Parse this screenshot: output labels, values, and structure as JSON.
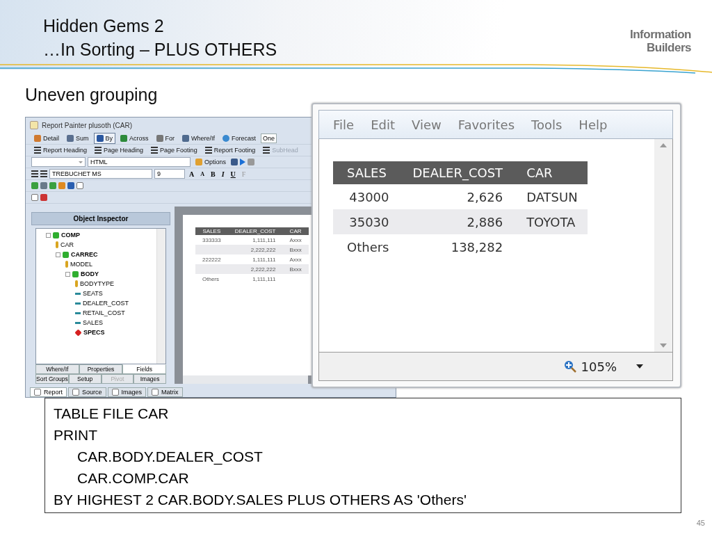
{
  "slide": {
    "title": "Hidden Gems 2",
    "subtitle": "…In Sorting – PLUS OTHERS",
    "logo_lines": [
      "Information",
      "Builders"
    ],
    "heading": "Uneven grouping",
    "page_number": "45"
  },
  "painter": {
    "title": "Report Painter plusoth (CAR)",
    "toolbar_1": [
      {
        "label": "Detail",
        "kind": "person",
        "selected": false
      },
      {
        "label": "Sum",
        "kind": "sigma",
        "selected": false
      },
      {
        "label": "By",
        "kind": "down",
        "selected": true
      },
      {
        "label": "Across",
        "kind": "right",
        "selected": false
      },
      {
        "label": "For",
        "kind": "list",
        "selected": false
      },
      {
        "label": "Where/If",
        "kind": "funnel",
        "selected": false
      },
      {
        "label": "Forecast",
        "kind": "globe",
        "selected": false
      }
    ],
    "toolbar_1_field": "One",
    "toolbar_2": [
      {
        "label": "Report Heading",
        "disabled": false
      },
      {
        "label": "Page Heading",
        "disabled": false
      },
      {
        "label": "Page Footing",
        "disabled": false
      },
      {
        "label": "Report Footing",
        "disabled": false
      },
      {
        "label": "SubHead",
        "disabled": true
      }
    ],
    "format_combo": "HTML",
    "options_button": "Options",
    "font_combo": "TREBUCHET MS",
    "size_combo": "9",
    "style_buttons": [
      "A",
      "A",
      "B",
      "I",
      "U",
      "F"
    ],
    "inspector_title": "Object Inspector",
    "tree": [
      {
        "label": "COMP",
        "kind": "segment",
        "children": [
          {
            "label": "CAR",
            "kind": "key"
          },
          {
            "label": "CARREC",
            "kind": "segment",
            "children": [
              {
                "label": "MODEL",
                "kind": "key"
              },
              {
                "label": "BODY",
                "kind": "segment",
                "children": [
                  {
                    "label": "BODYTYPE",
                    "kind": "key"
                  },
                  {
                    "label": "SEATS",
                    "kind": "field"
                  },
                  {
                    "label": "DEALER_COST",
                    "kind": "field"
                  },
                  {
                    "label": "RETAIL_COST",
                    "kind": "field"
                  },
                  {
                    "label": "SALES",
                    "kind": "field"
                  },
                  {
                    "label": "SPECS",
                    "kind": "subsegment"
                  }
                ]
              }
            ]
          }
        ]
      }
    ],
    "inspector_tabs": [
      [
        {
          "label": "Where/If",
          "selected": false,
          "disabled": false
        },
        {
          "label": "Properties",
          "selected": false,
          "disabled": false
        },
        {
          "label": "Fields",
          "selected": true,
          "disabled": false
        }
      ],
      [
        {
          "label": "Sort Groups",
          "selected": false,
          "disabled": false
        },
        {
          "label": "Setup",
          "selected": false,
          "disabled": false
        },
        {
          "label": "Pivot",
          "selected": false,
          "disabled": true
        },
        {
          "label": "Images",
          "selected": false,
          "disabled": false
        }
      ]
    ],
    "preview": {
      "columns": [
        "SALES",
        "DEALER_COST",
        "CAR"
      ],
      "rows": [
        [
          "333333",
          "1,111,111",
          "Axxx"
        ],
        [
          "",
          "2,222,222",
          "Bxxx"
        ],
        [
          "222222",
          "1,111,111",
          "Axxx"
        ],
        [
          "",
          "2,222,222",
          "Bxxx"
        ],
        [
          "Others",
          "1,111,111",
          ""
        ]
      ]
    },
    "bottom_tabs": [
      {
        "label": "Report",
        "selected": true
      },
      {
        "label": "Source",
        "selected": false
      },
      {
        "label": "Images",
        "selected": false
      },
      {
        "label": "Matrix",
        "selected": false
      }
    ]
  },
  "browser": {
    "menu": [
      "File",
      "Edit",
      "View",
      "Favorites",
      "Tools",
      "Help"
    ],
    "table": {
      "columns": [
        "SALES",
        "DEALER_COST",
        "CAR"
      ],
      "rows": [
        [
          "43000",
          "2,626",
          "DATSUN"
        ],
        [
          "35030",
          "2,886",
          "TOYOTA"
        ],
        [
          "Others",
          "138,282",
          ""
        ]
      ]
    },
    "zoom": "105%"
  },
  "code": [
    {
      "text": "TABLE FILE CAR",
      "indented": false
    },
    {
      "text": "PRINT",
      "indented": false
    },
    {
      "text": "CAR.BODY.DEALER_COST",
      "indented": true
    },
    {
      "text": "CAR.COMP.CAR",
      "indented": true
    },
    {
      "text": "BY  HIGHEST 2 CAR.BODY.SALES PLUS OTHERS AS 'Others'",
      "indented": false
    }
  ]
}
